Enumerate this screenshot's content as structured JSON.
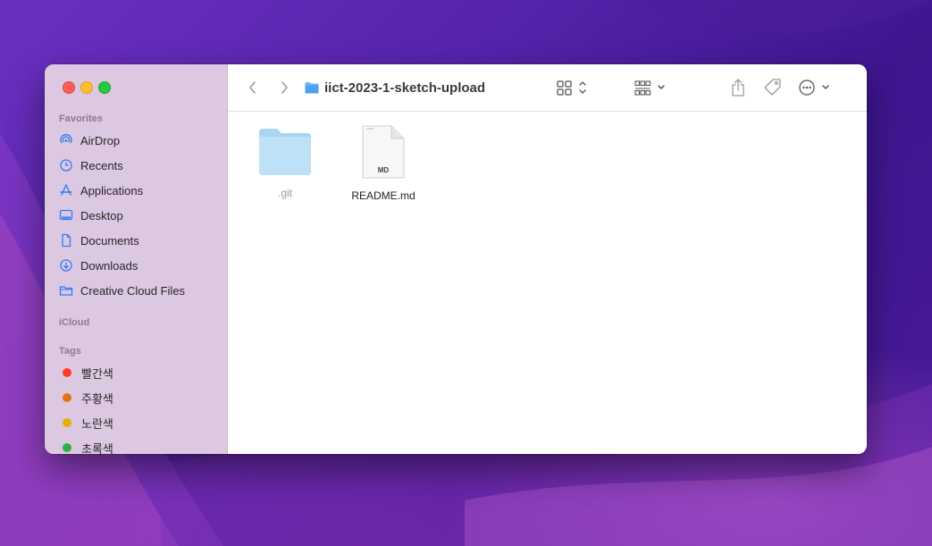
{
  "window": {
    "path_title": "iict-2023-1-sketch-upload"
  },
  "sidebar": {
    "favorites_title": "Favorites",
    "favorites": [
      {
        "label": "AirDrop",
        "icon": "airdrop-icon"
      },
      {
        "label": "Recents",
        "icon": "clock-icon"
      },
      {
        "label": "Applications",
        "icon": "applications-icon"
      },
      {
        "label": "Desktop",
        "icon": "desktop-icon"
      },
      {
        "label": "Documents",
        "icon": "document-icon"
      },
      {
        "label": "Downloads",
        "icon": "download-icon"
      },
      {
        "label": "Creative Cloud Files",
        "icon": "folder-icon"
      }
    ],
    "icloud_title": "iCloud",
    "tags_title": "Tags",
    "tags": [
      {
        "label": "빨간색",
        "color": "#ff3b30"
      },
      {
        "label": "주황색",
        "color": "#e3730e"
      },
      {
        "label": "노란색",
        "color": "#e5b100"
      },
      {
        "label": "초록색",
        "color": "#28b33f"
      }
    ]
  },
  "files": [
    {
      "name": ".git",
      "type": "folder",
      "hidden": true
    },
    {
      "name": "README.md",
      "type": "markdown",
      "badge": "MD"
    }
  ],
  "colors": {
    "accent": "#2f7cf6",
    "sidebar_bg": "#ddc8e1"
  }
}
